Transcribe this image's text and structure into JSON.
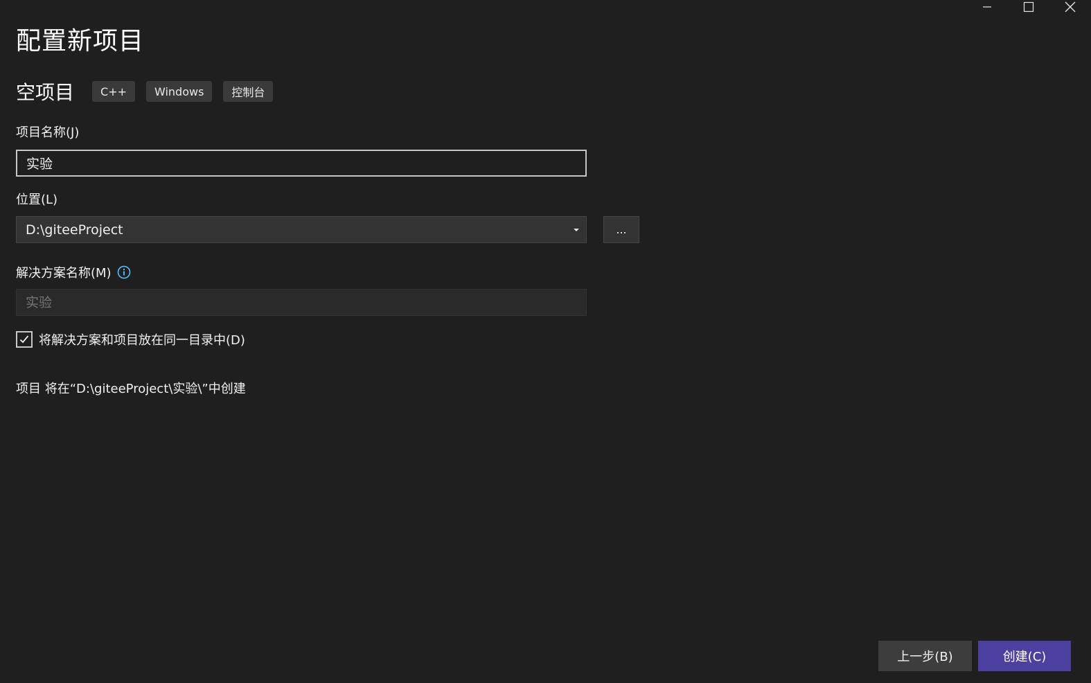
{
  "window_controls": {
    "minimize_icon": "minimize-icon",
    "maximize_icon": "maximize-icon",
    "close_icon": "close-icon"
  },
  "page_title": "配置新项目",
  "template": {
    "name": "空项目",
    "tags": [
      "C++",
      "Windows",
      "控制台"
    ]
  },
  "project_name": {
    "label": "项目名称(J)",
    "value": "实验"
  },
  "location": {
    "label": "位置(L)",
    "value": "D:\\giteeProject",
    "browse_label": "..."
  },
  "solution_name": {
    "label": "解决方案名称(M)",
    "placeholder": "实验",
    "info_icon": "info-icon"
  },
  "same_directory": {
    "label": "将解决方案和项目放在同一目录中(D)",
    "checked": true
  },
  "create_path_info": "项目 将在“D:\\giteeProject\\实验\\”中创建",
  "footer": {
    "back_label": "上一步(B)",
    "create_label": "创建(C)"
  },
  "colors": {
    "background": "#1f1f1f",
    "accent": "#4b3f9f",
    "info": "#4fc1ff"
  }
}
